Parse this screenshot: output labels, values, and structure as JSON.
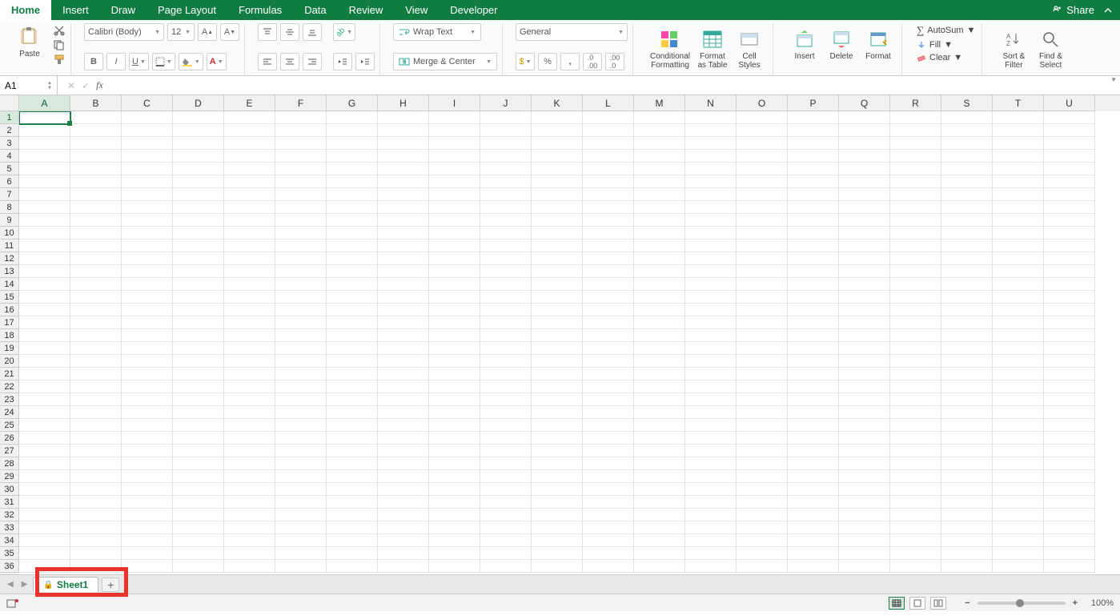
{
  "tabs": [
    "Home",
    "Insert",
    "Draw",
    "Page Layout",
    "Formulas",
    "Data",
    "Review",
    "View",
    "Developer"
  ],
  "active_tab": "Home",
  "share_label": "Share",
  "font": {
    "name": "Calibri (Body)",
    "size": "12"
  },
  "wrap_label": "Wrap Text",
  "merge_label": "Merge & Center",
  "number_format": "General",
  "big_buttons": {
    "paste": "Paste",
    "cond_fmt": "Conditional\nFormatting",
    "fmt_table": "Format\nas Table",
    "cell_styles": "Cell\nStyles",
    "insert": "Insert",
    "delete": "Delete",
    "format": "Format",
    "sort": "Sort &\nFilter",
    "find": "Find &\nSelect"
  },
  "editing": {
    "autosum": "AutoSum",
    "fill": "Fill",
    "clear": "Clear"
  },
  "name_box": "A1",
  "columns": [
    "A",
    "B",
    "C",
    "D",
    "E",
    "F",
    "G",
    "H",
    "I",
    "J",
    "K",
    "L",
    "M",
    "N",
    "O",
    "P",
    "Q",
    "R",
    "S",
    "T",
    "U"
  ],
  "row_count": 36,
  "selected_cell": {
    "row": 1,
    "col": "A"
  },
  "sheet_tab": "Sheet1",
  "zoom": "100%"
}
